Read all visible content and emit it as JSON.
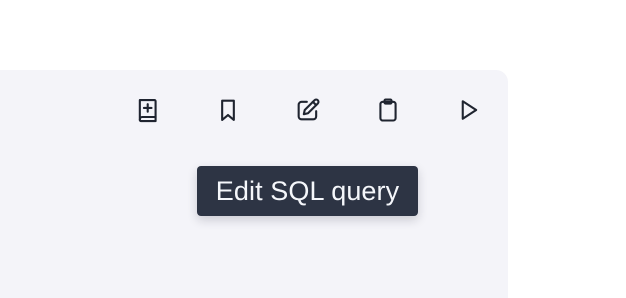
{
  "toolbar": {
    "buttons": [
      {
        "icon": "add-to-library-icon"
      },
      {
        "icon": "bookmark-icon"
      },
      {
        "icon": "edit-icon"
      },
      {
        "icon": "clipboard-icon"
      },
      {
        "icon": "play-icon"
      }
    ]
  },
  "tooltip": {
    "text": "Edit SQL query"
  },
  "colors": {
    "panel_background": "#f4f4f9",
    "icon_stroke": "#1f2430",
    "tooltip_background": "#2d3444",
    "tooltip_text": "#f5f7fb"
  }
}
